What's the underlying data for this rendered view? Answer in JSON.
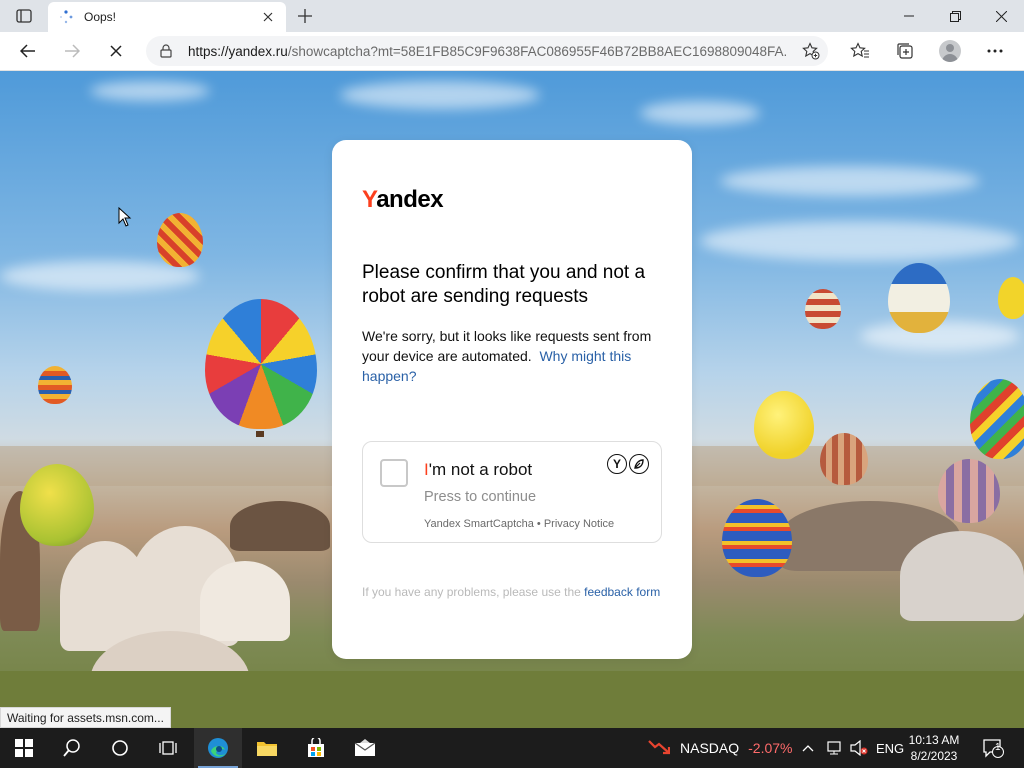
{
  "browser": {
    "tab_title": "Oops!",
    "url_host": "https://yandex.ru",
    "url_rest": "/showcaptcha?mt=58E1FB85C9F9638FAC086955F46B72BB8AEC1698809048FA..."
  },
  "captcha": {
    "logo_y": "Y",
    "logo_rest": "andex",
    "heading": "Please confirm that you and not a robot are sending requests",
    "description": "We're sorry, but it looks like requests sent from your device are automated.",
    "why_link": "Why might this happen?",
    "checkbox_accent": "I",
    "checkbox_label": "'m not a robot",
    "press_text": "Press to continue",
    "smartcaptcha_label": "Yandex SmartCaptcha",
    "separator": "•",
    "privacy_link": "Privacy Notice",
    "feedback_text": "If you have any problems, please use the",
    "feedback_link": "feedback form"
  },
  "status_bar": {
    "text": "Waiting for assets.msn.com..."
  },
  "taskbar": {
    "stock_name": "NASDAQ",
    "stock_change": "-2.07%",
    "language": "ENG",
    "time": "10:13 AM",
    "date": "8/2/2023",
    "notification_count": "1"
  },
  "colors": {
    "yandex_red": "#fc3f1d",
    "link_blue": "#2a61a7",
    "stock_negative": "#ff6b6b"
  }
}
